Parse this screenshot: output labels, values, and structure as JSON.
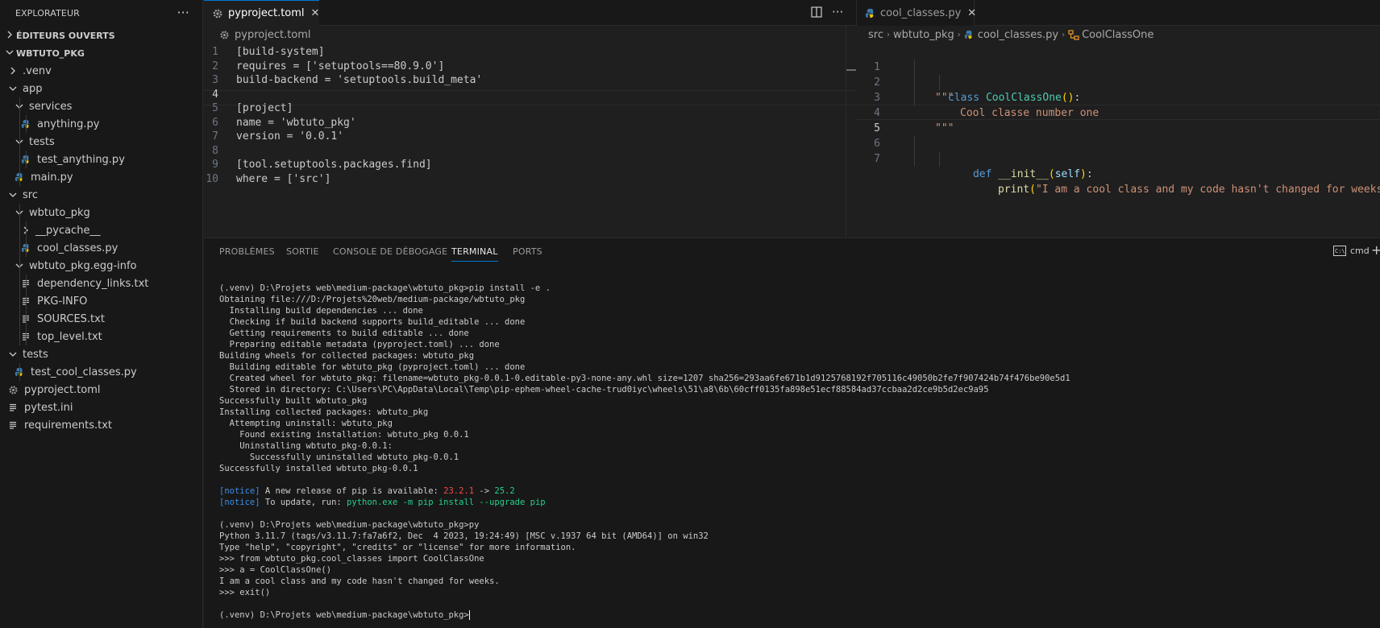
{
  "sidebar": {
    "title": "EXPLORATEUR",
    "more": "···",
    "open_editors": "ÉDITEURS OUVERTS",
    "project": "WBTUTO_PKG",
    "items": [
      {
        "label": ".venv"
      },
      {
        "label": "app"
      },
      {
        "label": "services"
      },
      {
        "label": "anything.py"
      },
      {
        "label": "tests"
      },
      {
        "label": "test_anything.py"
      },
      {
        "label": "main.py"
      },
      {
        "label": "src"
      },
      {
        "label": "wbtuto_pkg"
      },
      {
        "label": "__pycache__"
      },
      {
        "label": "cool_classes.py"
      },
      {
        "label": "wbtuto_pkg.egg-info"
      },
      {
        "label": "dependency_links.txt"
      },
      {
        "label": "PKG-INFO"
      },
      {
        "label": "SOURCES.txt"
      },
      {
        "label": "top_level.txt"
      },
      {
        "label": "tests"
      },
      {
        "label": "test_cool_classes.py"
      },
      {
        "label": "pyproject.toml"
      },
      {
        "label": "pytest.ini"
      },
      {
        "label": "requirements.txt"
      }
    ]
  },
  "editor_left": {
    "tab": "pyproject.toml",
    "close": "✕",
    "more": "···",
    "breadcrumb": "pyproject.toml",
    "line_numbers": [
      "1",
      "2",
      "3",
      "4",
      "5",
      "6",
      "7",
      "8",
      "9",
      "10"
    ],
    "lines": [
      "[build-system]",
      "requires = ['setuptools==80.9.0']",
      "build-backend = 'setuptools.build_meta'",
      "",
      "[project]",
      "name = 'wbtuto_pkg'",
      "version = '0.0.1'",
      "",
      "[tool.setuptools.packages.find]",
      "where = ['src']"
    ]
  },
  "editor_right": {
    "tab": "cool_classes.py",
    "close": "✕",
    "breadcrumb": {
      "src": "src",
      "pkg": "wbtuto_pkg",
      "file": "cool_classes.py",
      "symbol": "CoolClassOne"
    },
    "line_numbers": [
      "1",
      "2",
      "3",
      "4",
      "5",
      "6",
      "7"
    ],
    "code": {
      "l1_kw": "class",
      "l1_name": "CoolClassOne",
      "l1_paren": "()",
      "l1_colon": ":",
      "l2": "\"\"\"",
      "l3": "Cool classe number one",
      "l4": "\"\"\"",
      "l6_kw": "def",
      "l6_fn": "__init__",
      "l6_open": "(",
      "l6_self": "self",
      "l6_close": ")",
      "l6_colon": ":",
      "l7_fn": "print",
      "l7_open": "(",
      "l7_str": "\"I am a cool class and my code hasn't changed for weeks.\"",
      "l7_close": ")"
    }
  },
  "panel": {
    "tabs": [
      "PROBLÈMES",
      "SORTIE",
      "CONSOLE DE DÉBOGAGE",
      "TERMINAL",
      "PORTS"
    ],
    "shell": "cmd",
    "plus": "+"
  },
  "terminal": {
    "lines": [
      "(.venv) D:\\Projets web\\medium-package\\wbtuto_pkg>pip install -e .",
      "Obtaining file:///D:/Projets%20web/medium-package/wbtuto_pkg",
      "  Installing build dependencies ... done",
      "  Checking if build backend supports build_editable ... done",
      "  Getting requirements to build editable ... done",
      "  Preparing editable metadata (pyproject.toml) ... done",
      "Building wheels for collected packages: wbtuto_pkg",
      "  Building editable for wbtuto_pkg (pyproject.toml) ... done",
      "  Created wheel for wbtuto_pkg: filename=wbtuto_pkg-0.0.1-0.editable-py3-none-any.whl size=1207 sha256=293aa6fe671b1d9125768192f705116c49050b2fe7f907424b74f476be90e5d1",
      "  Stored in directory: C:\\Users\\PC\\AppData\\Local\\Temp\\pip-ephem-wheel-cache-trud0iyc\\wheels\\51\\a8\\6b\\60cff0135fa898e51ecf88584ad37ccbaa2d2ce9b5d2ec9a95",
      "Successfully built wbtuto_pkg",
      "Installing collected packages: wbtuto_pkg",
      "  Attempting uninstall: wbtuto_pkg",
      "    Found existing installation: wbtuto_pkg 0.0.1",
      "    Uninstalling wbtuto_pkg-0.0.1:",
      "      Successfully uninstalled wbtuto_pkg-0.0.1",
      "Successfully installed wbtuto_pkg-0.0.1"
    ],
    "notice1": {
      "tag": "[notice]",
      "text": " A new release of pip is available: ",
      "old": "23.2.1",
      "arrow": " -> ",
      "new": "25.2"
    },
    "notice2": {
      "tag": "[notice]",
      "text": " To update, run: ",
      "cmd": "python.exe -m pip install --upgrade pip"
    },
    "lines2": [
      "(.venv) D:\\Projets web\\medium-package\\wbtuto_pkg>py",
      "Python 3.11.7 (tags/v3.11.7:fa7a6f2, Dec  4 2023, 19:24:49) [MSC v.1937 64 bit (AMD64)] on win32",
      "Type \"help\", \"copyright\", \"credits\" or \"license\" for more information.",
      ">>> from wbtuto_pkg.cool_classes import CoolClassOne",
      ">>> a = CoolClassOne()",
      "I am a cool class and my code hasn't changed for weeks.",
      ">>> exit()"
    ],
    "prompt": "(.venv) D:\\Projets web\\medium-package\\wbtuto_pkg>"
  },
  "colors": {
    "accent": "#0078d4",
    "folder_chevron": "#cccccc",
    "python_icon": "#3c78aa",
    "toml_icon": "#9f9f9f"
  }
}
